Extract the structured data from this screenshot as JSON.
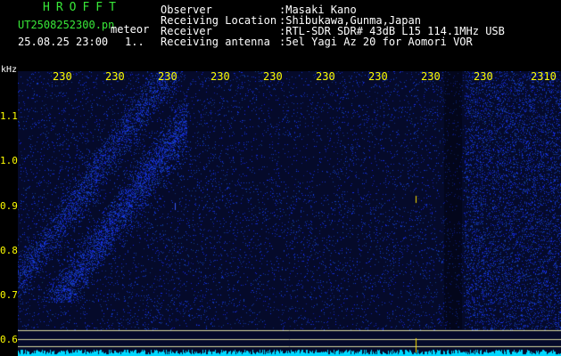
{
  "header": {
    "brand": "HROFFT",
    "filename": "UT2508252300.pn",
    "meteor_label": "meteor",
    "datetime": "25.08.25 23:00",
    "counter": "1..",
    "info": [
      {
        "label": "Observer",
        "value": ":Masaki Kano"
      },
      {
        "label": "Receiving Location",
        "value": ":Shibukawa,Gunma,Japan"
      },
      {
        "label": "Receiver",
        "value": ":RTL-SDR SDR# 43dB L15 114.1MHz USB"
      },
      {
        "label": "Receiving antenna",
        "value": ":5el Yagi Az 20 for Aomori VOR"
      }
    ]
  },
  "plot": {
    "y_unit": "kHz",
    "x_ticks": [
      "230",
      "230",
      "230",
      "230",
      "230",
      "230",
      "230",
      "230",
      "230",
      "2310"
    ],
    "y_ticks": [
      "1.1",
      "1.0",
      "0.9",
      "0.8",
      "0.7",
      "0.6"
    ]
  },
  "colors": {
    "background": "#000000",
    "text_white": "#ffffff",
    "text_green": "#38e838",
    "tick_yellow": "#ffff00",
    "noise_blue": "#2a3cff",
    "signal_cyan": "#00e5ff"
  }
}
